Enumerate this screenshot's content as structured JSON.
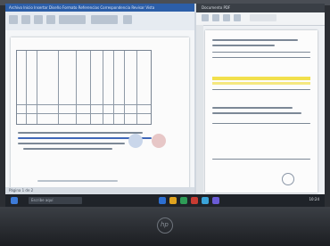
{
  "left_window": {
    "menu": "Archivo  Inicio  Insertar  Diseño  Formato  Referencias  Correspondencia  Revisar  Vista",
    "status": "Página 1 de 2"
  },
  "right_window": {
    "tab": "Documento PDF"
  },
  "taskbar": {
    "search_placeholder": "Escribe aquí",
    "time": "10:24"
  },
  "brand": {
    "logo": "hp"
  }
}
